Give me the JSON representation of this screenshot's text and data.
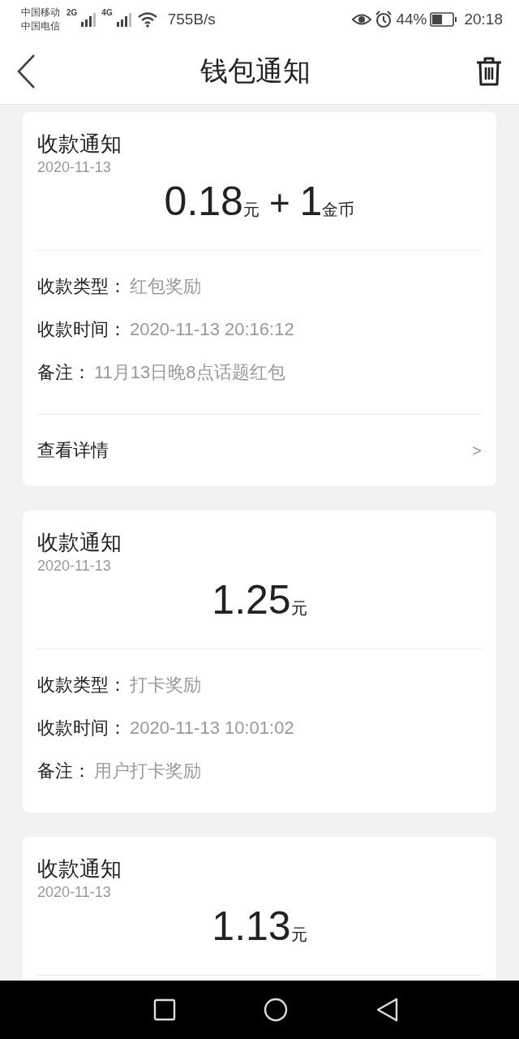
{
  "status_bar": {
    "carriers": [
      "中国移动",
      "中国电信"
    ],
    "networks": [
      "2G",
      "4G"
    ],
    "speed": "755B/s",
    "battery": "44%",
    "time": "20:18"
  },
  "header": {
    "title": "钱包通知"
  },
  "notifications": [
    {
      "title": "收款通知",
      "date": "2020-11-13",
      "amount": [
        {
          "kind": "number",
          "text": "0.18"
        },
        {
          "kind": "unit",
          "text": "元"
        },
        {
          "kind": "operator",
          "text": "+"
        },
        {
          "kind": "number",
          "text": "1"
        },
        {
          "kind": "unit",
          "text": "金币"
        }
      ],
      "rows": [
        {
          "label": "收款类型：",
          "value": "红包奖励"
        },
        {
          "label": "收款时间：",
          "value": "2020-11-13 20:16:12"
        },
        {
          "label": "备注：",
          "value": "11月13日晚8点话题红包"
        }
      ],
      "link": {
        "label": "查看详情",
        "arrow": ">"
      }
    },
    {
      "title": "收款通知",
      "date": "2020-11-13",
      "amount": [
        {
          "kind": "number",
          "text": "1.25"
        },
        {
          "kind": "unit",
          "text": "元"
        }
      ],
      "rows": [
        {
          "label": "收款类型：",
          "value": "打卡奖励"
        },
        {
          "label": "收款时间：",
          "value": "2020-11-13 10:01:02"
        },
        {
          "label": "备注：",
          "value": "用户打卡奖励"
        }
      ]
    },
    {
      "title": "收款通知",
      "date": "2020-11-13",
      "amount": [
        {
          "kind": "number",
          "text": "1.13"
        },
        {
          "kind": "unit",
          "text": "元"
        }
      ]
    }
  ]
}
